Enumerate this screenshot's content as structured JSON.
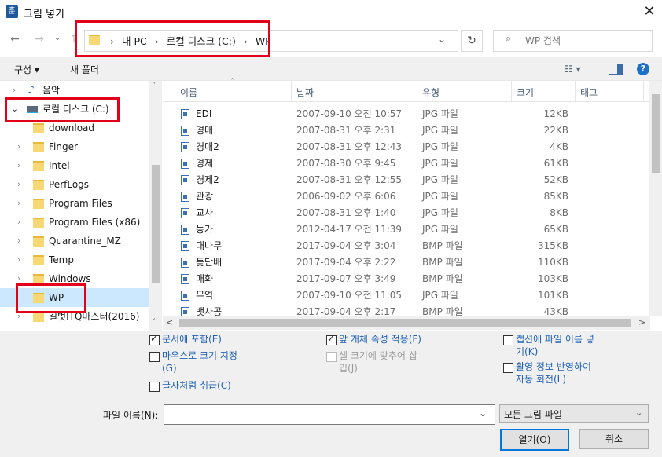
{
  "window": {
    "title": "그림 넣기",
    "icon_glyph": "훈",
    "close_glyph": "✕"
  },
  "nav": {
    "back": "←",
    "forward": "→",
    "recent": "⌄",
    "up": "↑"
  },
  "address": {
    "crumbs": [
      "내 PC",
      "로컬 디스크 (C:)",
      "WP"
    ],
    "sep": "›",
    "dropdown": "⌄",
    "refresh": "↻"
  },
  "search": {
    "placeholder": "WP 검색",
    "icon": "⌕"
  },
  "toolbar": {
    "organize": "구성 ▾",
    "new_folder": "새 폴더",
    "view_glyph": "☷ ▾",
    "help": "?"
  },
  "tree": {
    "music": "음악",
    "local_disk": "로컬 디스크 (C:)",
    "folders": [
      "download",
      "Finger",
      "Intel",
      "PerfLogs",
      "Program Files",
      "Program Files (x86)",
      "Quarantine_MZ",
      "Temp",
      "Windows",
      "WP",
      "길벗ITQ마스터(2016)"
    ],
    "scroll_up": "˄",
    "scroll_down": "˅"
  },
  "list": {
    "columns": [
      "이름",
      "날짜",
      "유형",
      "크기",
      "태그"
    ],
    "rows": [
      {
        "name": "EDI",
        "date": "2007-09-10 오전 10:57",
        "type": "JPG 파일",
        "size": "12KB"
      },
      {
        "name": "경매",
        "date": "2007-08-31 오후 2:31",
        "type": "JPG 파일",
        "size": "22KB"
      },
      {
        "name": "경매2",
        "date": "2007-08-31 오후 12:43",
        "type": "JPG 파일",
        "size": "4KB"
      },
      {
        "name": "경제",
        "date": "2007-08-30 오후 9:45",
        "type": "JPG 파일",
        "size": "61KB"
      },
      {
        "name": "경제2",
        "date": "2007-08-31 오후 12:55",
        "type": "JPG 파일",
        "size": "52KB"
      },
      {
        "name": "관광",
        "date": "2006-09-02 오후 6:06",
        "type": "JPG 파일",
        "size": "85KB"
      },
      {
        "name": "교사",
        "date": "2007-08-31 오후 1:40",
        "type": "JPG 파일",
        "size": "8KB"
      },
      {
        "name": "농가",
        "date": "2012-04-17 오전 11:39",
        "type": "JPG 파일",
        "size": "65KB"
      },
      {
        "name": "대나무",
        "date": "2017-09-04 오후 3:04",
        "type": "BMP 파일",
        "size": "315KB"
      },
      {
        "name": "돛단배",
        "date": "2017-09-04 오후 2:22",
        "type": "BMP 파일",
        "size": "110KB"
      },
      {
        "name": "매화",
        "date": "2017-09-07 오후 3:49",
        "type": "BMP 파일",
        "size": "103KB"
      },
      {
        "name": "무역",
        "date": "2007-09-10 오전 11:05",
        "type": "JPG 파일",
        "size": "101KB"
      },
      {
        "name": "뱃사공",
        "date": "2017-09-04 오후 2:17",
        "type": "BMP 파일",
        "size": "43KB"
      }
    ],
    "sort_glyph": "˄",
    "hscroll_left": "<",
    "hscroll_right": ">"
  },
  "options": {
    "include_doc": "문서에 포함(E)",
    "mouse_size_l1": "마우스로 크기 지정",
    "mouse_size_l2": "(G)",
    "as_char": "글자처럼 취급(C)",
    "apply_prev": "앞 개체 속성 적용(F)",
    "cell_fit_l1": "셀 크기에 맞추어 삽",
    "cell_fit_l2": "입(J)",
    "caption_l1": "캡션에 파일 이름 넣",
    "caption_l2": "기(K)",
    "rotate_l1": "촬영 정보 반영하여",
    "rotate_l2": "자동 회전(L)"
  },
  "filename": {
    "label": "파일 이름(N):",
    "value": "",
    "dropdown": "⌄"
  },
  "filetype": {
    "selected": "모든 그림 파일",
    "dropdown": "⌄"
  },
  "buttons": {
    "open": "열기(O)",
    "cancel": "취소"
  }
}
